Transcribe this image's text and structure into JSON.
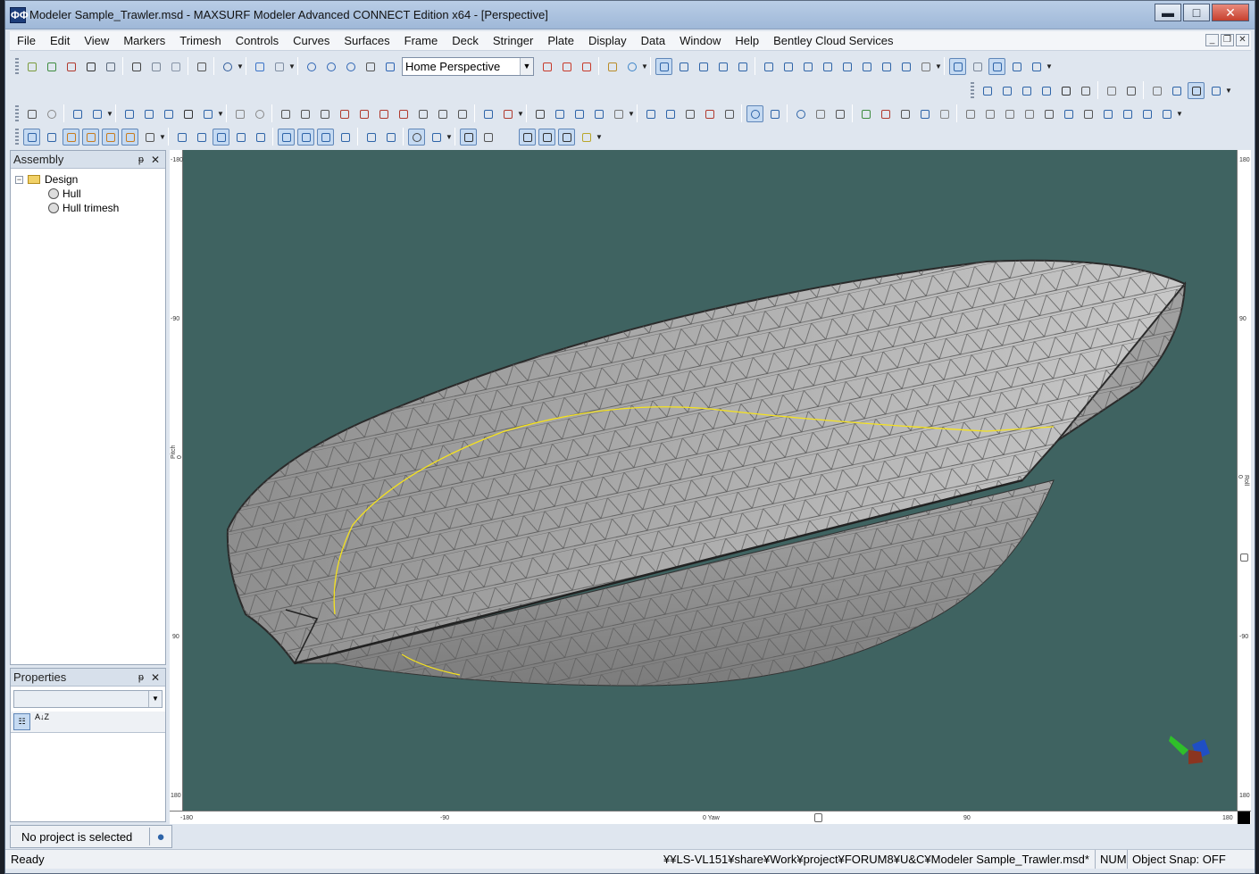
{
  "window": {
    "title": "Modeler Sample_Trawler.msd - MAXSURF Modeler Advanced CONNECT Edition x64 - [Perspective]",
    "app_icon": "ΦΦ",
    "minimize": "▬",
    "maximize": "□",
    "close": "✕"
  },
  "menu": [
    "File",
    "Edit",
    "View",
    "Markers",
    "Trimesh",
    "Controls",
    "Curves",
    "Surfaces",
    "Frame",
    "Deck",
    "Stringer",
    "Plate",
    "Display",
    "Data",
    "Window",
    "Help",
    "Bentley Cloud Services"
  ],
  "view_selector": {
    "value": "Home Perspective"
  },
  "assembly": {
    "title": "Assembly",
    "pin": "ᵽ",
    "close": "✕",
    "expand": "−",
    "root": "Design",
    "items": [
      "Hull",
      "Hull trimesh"
    ]
  },
  "properties": {
    "title": "Properties",
    "pin": "ᵽ",
    "close": "✕",
    "sort_alpha": "A↓Z"
  },
  "project": {
    "status": "No project is selected"
  },
  "rulers": {
    "left": [
      "-180",
      "-90",
      "Pitch 0",
      "90",
      "180"
    ],
    "right": [
      "180",
      "90",
      "Roll 0",
      "-90",
      "180"
    ],
    "bottom": [
      "-180",
      "-90",
      "0 Yaw",
      "90",
      "180"
    ]
  },
  "status": {
    "ready": "Ready",
    "path": "¥¥LS-VL151¥share¥Work¥project¥FORUM8¥U&C¥Modeler Sample_Trawler.msd*",
    "num": "NUM",
    "snap": "Object Snap: OFF"
  },
  "colors": {
    "viewport": "#3f6361",
    "hull_fill": "#9d9d9d",
    "sheer_line": "#f5e21e"
  }
}
